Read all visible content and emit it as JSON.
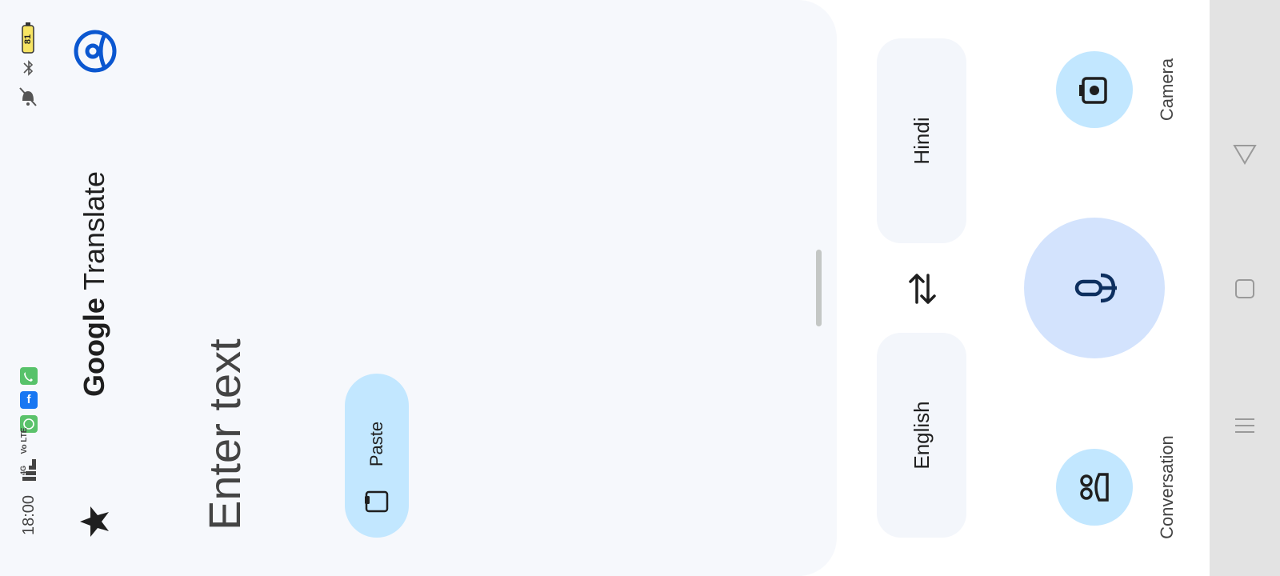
{
  "status_bar": {
    "time": "18:00",
    "battery": "81",
    "network": "4G",
    "volte": "Vo LTE",
    "roaming": "R"
  },
  "header": {
    "brand": "Google",
    "product": "Translate"
  },
  "input": {
    "placeholder": "Enter text"
  },
  "paste": {
    "label": "Paste"
  },
  "languages": {
    "source": "English",
    "target": "Hindi"
  },
  "actions": {
    "camera_label": "Camera",
    "conversation_label": "Conversation"
  },
  "colors": {
    "panel_bg": "#f6f8fc",
    "accent_light": "#c2e7ff",
    "mic_bg": "#d3e3fd",
    "brand_blue": "#0b57d0"
  }
}
